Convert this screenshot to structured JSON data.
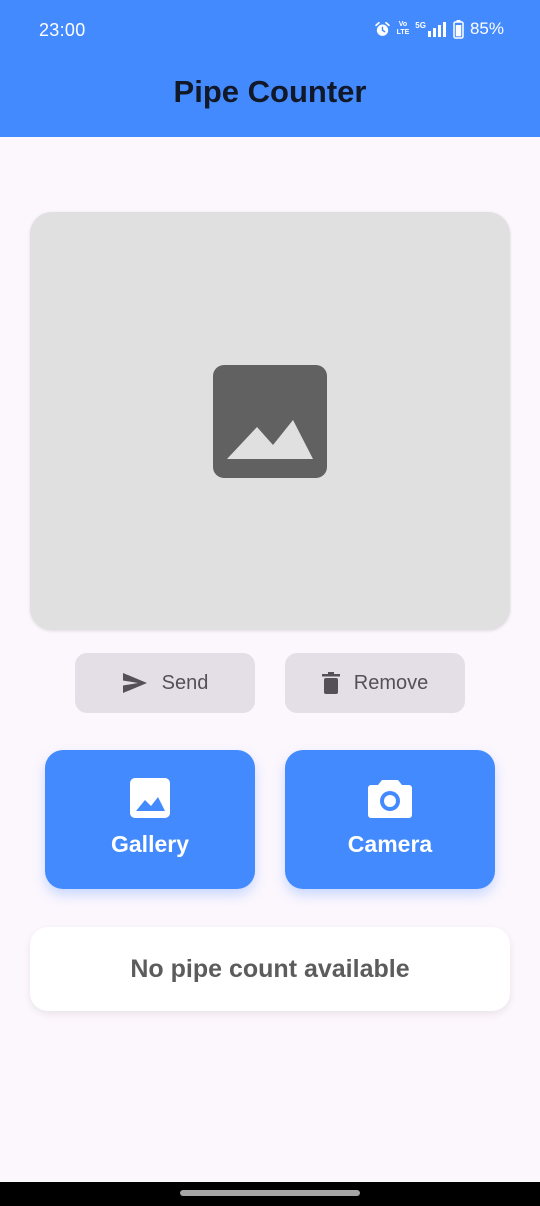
{
  "status_bar": {
    "time": "23:00",
    "network": "5G",
    "volte_top": "Vo",
    "volte_bottom": "LTE",
    "battery": "85%"
  },
  "app_bar": {
    "title": "Pipe Counter"
  },
  "preview": {
    "placeholder_icon": "image-icon"
  },
  "actions": {
    "send_label": "Send",
    "send_icon": "send-icon",
    "remove_label": "Remove",
    "remove_icon": "trash-icon"
  },
  "sources": {
    "gallery_label": "Gallery",
    "gallery_icon": "image-icon",
    "camera_label": "Camera",
    "camera_icon": "camera-icon"
  },
  "result": {
    "text": "No pipe count available"
  },
  "colors": {
    "primary": "#448aff",
    "background": "#fcf7fd",
    "preview_bg": "#e0e0e0",
    "secondary_button": "#e4dfe6"
  }
}
